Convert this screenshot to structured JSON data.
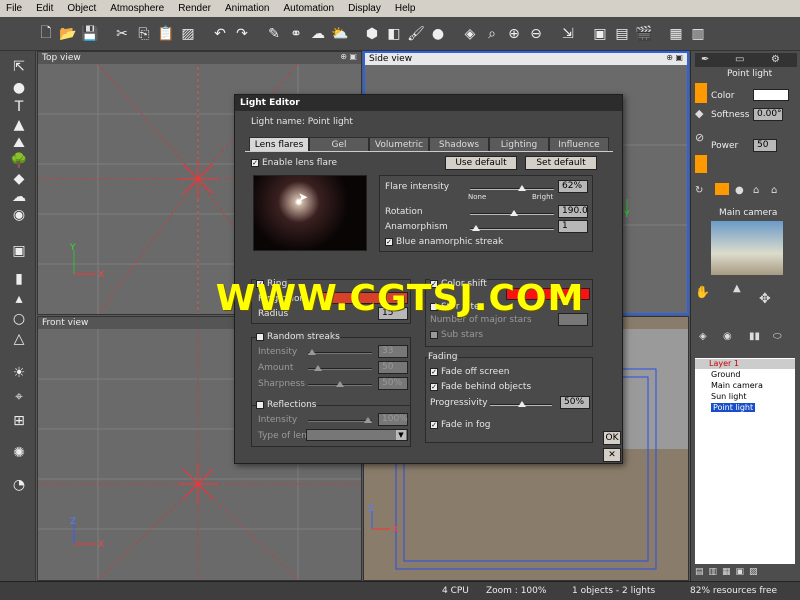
{
  "menu": [
    "File",
    "Edit",
    "Object",
    "Atmosphere",
    "Render",
    "Animation",
    "Automation",
    "Display",
    "Help"
  ],
  "viewports": {
    "top": "Top view",
    "side": "Side view",
    "front": "Front view"
  },
  "axes": {
    "x": "X",
    "y": "Y",
    "z": "Z"
  },
  "right_panel": {
    "title": "Point light",
    "color_label": "Color",
    "softness_label": "Softness",
    "softness_value": "0.00°",
    "power_label": "Power",
    "power_value": "50",
    "camera_title": "Main camera",
    "layers": [
      "Layer 1",
      "Ground",
      "Main camera",
      "Sun light",
      "Point light"
    ]
  },
  "status": {
    "cpu": "4 CPU",
    "zoom": "Zoom : 100%",
    "objects": "1 objects - 2 lights",
    "resources": "82% resources free"
  },
  "dialog": {
    "title": "Light Editor",
    "light_name": "Light name: Point light",
    "tabs": [
      "Lens flares",
      "Gel",
      "Volumetric",
      "Shadows",
      "Lighting",
      "Influence"
    ],
    "enable_lens_flare": "Enable lens flare",
    "use_default": "Use default",
    "set_default": "Set default",
    "flare_intensity": "Flare intensity",
    "flare_intensity_value": "62%",
    "none": "None",
    "bright": "Bright",
    "rotation": "Rotation",
    "rotation_value": "190.0",
    "anamorphism": "Anamorphism",
    "anamorphism_value": "1",
    "blue_streak": "Blue anamorphic streak",
    "ring": "Ring",
    "ring_color": "Ring color",
    "radius": "Radius",
    "radius_value": "15",
    "color_shift": "Color shift",
    "star_filter": "Star filter",
    "major_stars": "Number of major stars",
    "sub_stars": "Sub stars",
    "random_streaks": "Random streaks",
    "intensity": "Intensity",
    "intensity_value": "33",
    "amount": "Amount",
    "amount_value": "50",
    "sharpness": "Sharpness",
    "sharpness_value": "50%",
    "fading": "Fading",
    "fade_off_screen": "Fade off screen",
    "fade_behind": "Fade behind objects",
    "progressivity": "Progressivity",
    "progressivity_value": "50%",
    "fade_in_fog": "Fade in fog",
    "reflections": "Reflections",
    "refl_intensity": "Intensity",
    "refl_intensity_value": "100%",
    "type_of_lens": "Type of lens",
    "ok": "OK",
    "close": "✕"
  },
  "watermark": "WWW.CGTSJ.COM",
  "colors": {
    "ring": "#d8402a",
    "color_shift": "#ff1010",
    "accent": "#ff9900"
  }
}
